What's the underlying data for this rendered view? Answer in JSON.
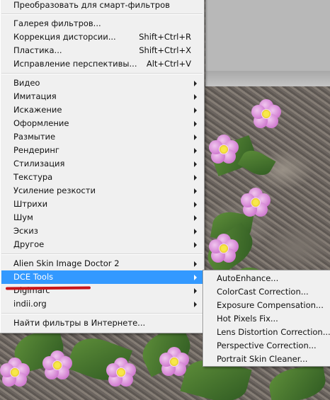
{
  "menu": {
    "top_item": "Преобразовать для смарт-фильтров",
    "filter_items": [
      {
        "label": "Галерея фильтров...",
        "shortcut": ""
      },
      {
        "label": "Коррекция дисторсии...",
        "shortcut": "Shift+Ctrl+R"
      },
      {
        "label": "Пластика...",
        "shortcut": "Shift+Ctrl+X"
      },
      {
        "label": "Исправление перспективы...",
        "shortcut": "Alt+Ctrl+V"
      }
    ],
    "category_items": [
      "Видео",
      "Имитация",
      "Искажение",
      "Оформление",
      "Размытие",
      "Рендеринг",
      "Стилизация",
      "Текстура",
      "Усиление резкости",
      "Штрихи",
      "Шум",
      "Эскиз",
      "Другое"
    ],
    "plugin_items": [
      "Alien Skin Image Doctor 2",
      "DCE Tools",
      "Digimarc",
      "indii.org"
    ],
    "highlighted_item": "DCE Tools",
    "online_item": "Найти фильтры в Интернете..."
  },
  "submenu": {
    "items": [
      "AutoEnhance...",
      "ColorCast Correction...",
      "Exposure Compensation...",
      "Hot Pixels Fix...",
      "Lens Distortion Correction...",
      "Perspective Correction...",
      "Portrait Skin Cleaner..."
    ]
  },
  "colors": {
    "menu_background": "#f0f0f0",
    "highlight": "#3399ff",
    "annotation_underline": "#c9151a"
  }
}
